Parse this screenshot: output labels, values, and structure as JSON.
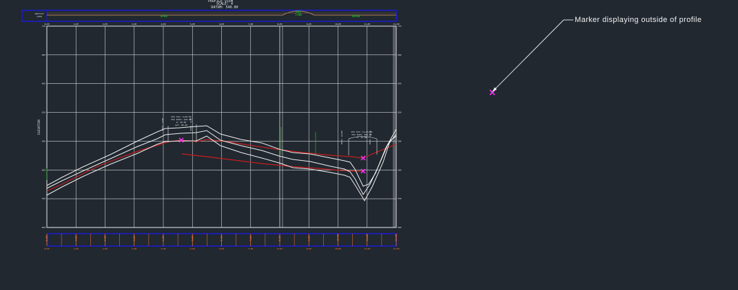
{
  "header": {
    "scale_text": "SCALE: 4",
    "datum_text": "DATUM: 540.00"
  },
  "annotation": {
    "callout_text": "Marker displaying outside of profile"
  },
  "profile": {
    "y_axis_label": "ELEVATION",
    "station_labels": [
      "0+00",
      "1+00",
      "2+00",
      "3+00",
      "4+00",
      "5+00",
      "6+00",
      "7+00",
      "8+00",
      "9+00",
      "10+00",
      "11+00",
      "12+00"
    ],
    "elevation_labels": [
      "710",
      "680",
      "650",
      "620",
      "590",
      "560",
      "530",
      "500"
    ]
  },
  "colors": {
    "background": "#212830",
    "grid": "#d9d9d9",
    "frame": "#ffffff",
    "band_border": "#1a1ad6",
    "existing_ground": "#c81e1e",
    "design_profile": "#f0f0f0",
    "marker": "#ff33ff",
    "text_green": "#22dd22",
    "text_orange": "#ff7a3a",
    "tan_line": "#b8845a"
  }
}
